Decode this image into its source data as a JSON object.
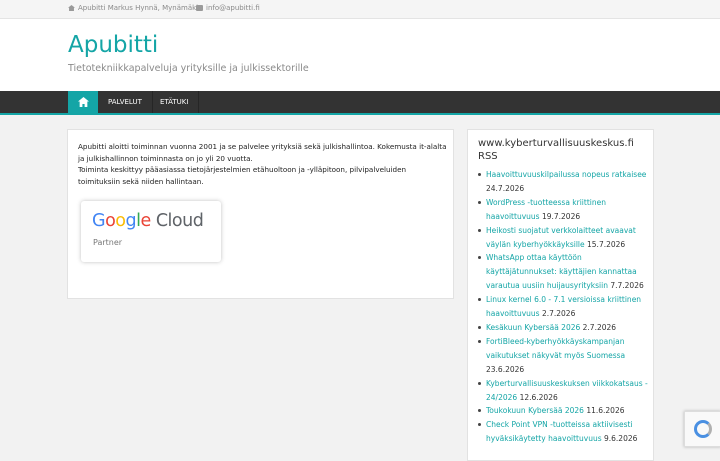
{
  "topbar": {
    "address": "Apubitti Markus Hynnä, Mynämäki",
    "email": "info@apubitti.fi",
    "address_icon": "home-icon",
    "email_icon": "mail-icon"
  },
  "header": {
    "title": "Apubitti",
    "description": "Tietotekniikkapalveluja yrityksille ja julkissektorille"
  },
  "nav": {
    "home_icon": "home-icon",
    "items": [
      {
        "label": "PALVELUT"
      },
      {
        "label": "ETÄTUKI"
      }
    ]
  },
  "main": {
    "paragraph1": "Apubitti aloitti toiminnan vuonna 2001 ja se palvelee yrityksiä sekä julkishallintoa. Kokemusta it-alalta ja julkishallinnon toiminnasta on jo yli 20 vuotta.",
    "paragraph2": "Toiminta keskittyy pääasiassa tietojärjestelmien etähuoltoon ja -ylläpitoon, pilvipalveluiden toimituksiin sekä niiden hallintaan.",
    "badge": {
      "brand": "Google Cloud",
      "caption": "Partner"
    }
  },
  "sidebar": {
    "title": "www.kyberturvallisuuskeskus.fi RSS",
    "items": [
      {
        "title": "Haavoittuvuuskilpailussa nopeus ratkaisee",
        "date": "24.7.2026"
      },
      {
        "title": "WordPress -tuotteessa kriittinen haavoittuvuus",
        "date": "19.7.2026"
      },
      {
        "title": "Heikosti suojatut verkkolaitteet avaavat väylän kyberhyökkäyksille",
        "date": "15.7.2026"
      },
      {
        "title": "WhatsApp ottaa käyttöön käyttäjätunnukset: käyttäjien kannattaa varautua uusiin huijausyrityksiin",
        "date": "7.7.2026"
      },
      {
        "title": "Linux kernel 6.0 - 7.1 versioissa kriittinen haavoittuvuus",
        "date": "2.7.2026"
      },
      {
        "title": "Kesäkuun Kybersää 2026",
        "date": "2.7.2026"
      },
      {
        "title": "FortiBleed-kyberhyökkäyskampanjan vaikutukset näkyvät myös Suomessa",
        "date": "23.6.2026"
      },
      {
        "title": "Kyberturvallisuuskeskuksen viikkokatsaus - 24/2026",
        "date": "12.6.2026"
      },
      {
        "title": "Toukokuun Kybersää 2026",
        "date": "11.6.2026"
      },
      {
        "title": "Check Point VPN -tuotteissa aktiivisesti hyväksikäytetty haavoittuvuus",
        "date": "9.6.2026"
      }
    ]
  },
  "colors": {
    "accent": "#14a5a6",
    "nav_bg": "#333333",
    "google_blue": "#4285F4",
    "google_red": "#EA4335",
    "google_yellow": "#FBBC05",
    "google_green": "#34A853"
  }
}
